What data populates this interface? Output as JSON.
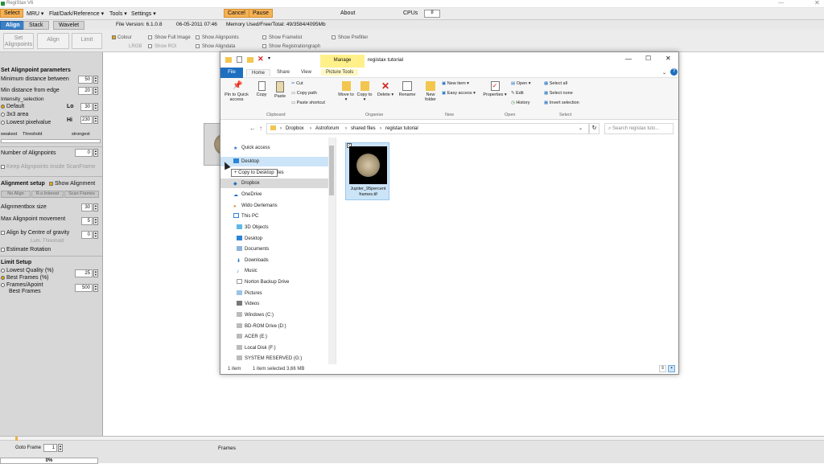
{
  "app": {
    "title": "RegiStax V6"
  },
  "menu": {
    "select": "Select",
    "mru": "MRU ▾",
    "flat": "Flat/Dark/Reference ▾",
    "tools": "Tools ▾",
    "settings": "Settings ▾",
    "cancel": "Cancel",
    "pause": "Pause",
    "about": "About",
    "cpus_label": "CPUs",
    "cpus_value": "8"
  },
  "tabs": {
    "align": "Align",
    "stack": "Stack",
    "wavelet": "Wavelet"
  },
  "fileinfo": {
    "version": "File Version: 6.1.0.8",
    "date": "06-05-2011 07:46",
    "memory": "Memory Used/Free/Total: 49/3584/4095Mb"
  },
  "toolbar": {
    "set_alignpoints_1": "Set",
    "set_alignpoints_2": "Alignpoints",
    "align": "Align",
    "limit": "Limit",
    "colour": "Colour",
    "show_full_image": "Show Full Image",
    "show_alignpoints": "Show Alignpoints",
    "show_framelist": "Show Framelist",
    "show_prefilter": "Show Prefilter",
    "lrgb": "LRGB",
    "show_roi": "Show ROI",
    "show_aligndata": "Show Aligndata",
    "show_registrationgraph": "Show Registrationgraph"
  },
  "left": {
    "set_alignpoint_params": "Set Alignpoint parameters",
    "min_distance": "Minimum distance between",
    "min_distance_value": "50",
    "min_edge": "Min distance from edge",
    "min_edge_value": "20",
    "intensity_selection": "Intensity_selection",
    "default": "Default",
    "lo": "Lo",
    "lo_value": "30",
    "area": "3x3 area",
    "hi": "Hi",
    "hi_value": "230",
    "lowest_pixel": "Lowest pixelvalue",
    "weakest": "weakest",
    "threshold": "Threshold",
    "strongest": "strongest",
    "number_alignpoints": "Number of Alignpoints",
    "number_alignpoints_value": "0",
    "keep_alignpoints": "Keep Alignpoints inside ScanFrame",
    "alignment_setup": "Alignment setup",
    "show_alignment": "Show Alignment",
    "no_align": "No Align",
    "roi_interest": "R.o.Interest",
    "scan_frames": "Scan Frames",
    "alignbox_size": "Alignmentbox size",
    "alignbox_value": "30",
    "max_movement": "Max Alignpoint movement",
    "max_movement_value": "5",
    "align_centre": "Align by Centre of gravity",
    "align_centre_value": "0",
    "lum_threshold": "Lum. Threshold",
    "estimate_rotation": "Estimate Rotation",
    "limit_setup": "Limit Setup",
    "lowest_quality": "Lowest Quality (%)",
    "lowest_quality_value": "25",
    "best_frames_pct": "Best Frames (%)",
    "frames_apoint": "Frames/Apoint",
    "best_frames": "Best Frames",
    "best_frames_value": "500"
  },
  "bottom": {
    "goto_frame": "Goto Frame",
    "goto_value": "1",
    "frames": "Frames",
    "progress": "0%"
  },
  "drag": {
    "copy_to_desktop": "+ Copy to Desktop"
  },
  "explorer": {
    "manage": "Manage",
    "title": "registax tutorial",
    "ribbon_tabs": [
      "File",
      "Home",
      "Share",
      "View",
      "Picture Tools"
    ],
    "pin": "Pin to Quick access",
    "copy": "Copy",
    "paste": "Paste",
    "cut": "Cut",
    "copy_path": "Copy path",
    "paste_shortcut": "Paste shortcut",
    "clipboard": "Clipboard",
    "move_to": "Move to ▾",
    "copy_to": "Copy to ▾",
    "delete": "Delete ▾",
    "rename": "Rename",
    "organise": "Organise",
    "new_folder": "New folder",
    "new_item": "New item ▾",
    "easy_access": "Easy access ▾",
    "new": "New",
    "properties": "Properties ▾",
    "open": "Open ▾",
    "edit": "Edit",
    "history": "History",
    "open_group": "Open",
    "select_all": "Select all",
    "select_none": "Select none",
    "invert_selection": "Invert selection",
    "select_group": "Select",
    "breadcrumb": [
      "Dropbox",
      "Astroforum",
      "shared files",
      "registax tutorial"
    ],
    "search_placeholder": "Search registax tuto...",
    "nav": [
      "Quick access",
      "Desktop",
      "Files",
      "Dropbox",
      "OneDrive",
      "Wido Oerlemans",
      "This PC",
      "3D Objects",
      "Desktop",
      "Documents",
      "Downloads",
      "Music",
      "Norton Backup Drive",
      "Pictures",
      "Videos",
      "Windows (C:)",
      "BD-ROM Drive (D:)",
      "ACER (E:)",
      "Local Disk (F:)",
      "SYSTEM RESERVED (G:)"
    ],
    "file_name_1": "Jupiter_95percent",
    "file_name_2": "frames.tif",
    "status_items": "1 item",
    "status_selected": "1 item selected  3,66 MB"
  }
}
